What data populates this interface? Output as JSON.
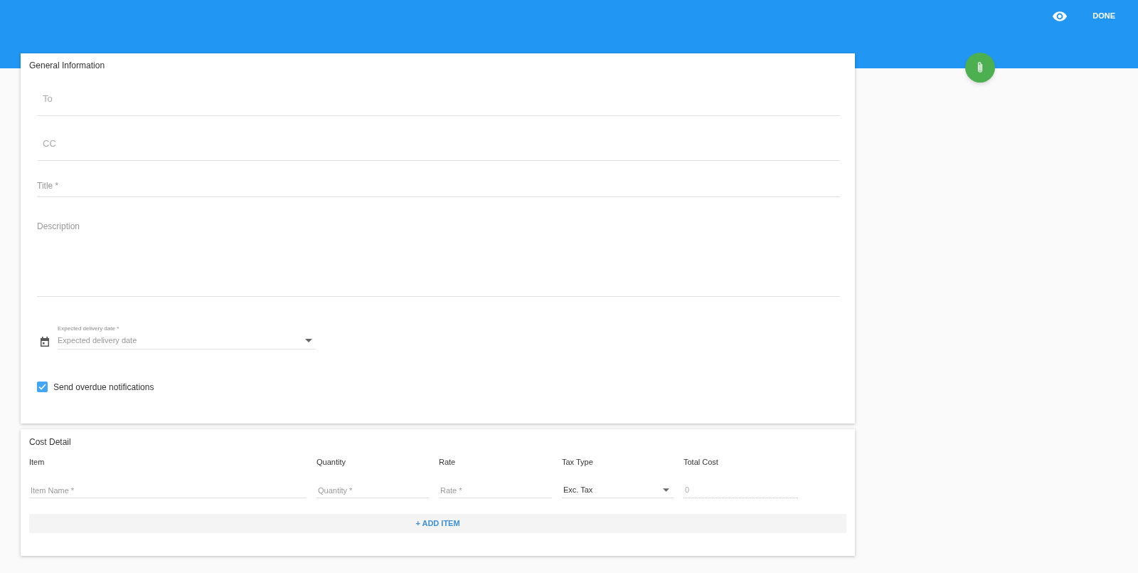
{
  "toolbar": {
    "done_label": "DONE"
  },
  "general_information": {
    "title": "General Information",
    "fields": [
      {
        "kind": "recipient",
        "placeholder": "To"
      },
      {
        "kind": "recipient",
        "placeholder": "CC"
      },
      {
        "kind": "single",
        "placeholder": "Title *"
      },
      {
        "kind": "multiline",
        "placeholder": "Description"
      }
    ],
    "delivery_date": {
      "label": "Expected delivery date *",
      "placeholder": "Expected delivery date"
    },
    "overdue_notifications": {
      "label": "Send overdue notifications",
      "checked": true
    }
  },
  "cost_detail": {
    "title": "Cost Detail",
    "columns": [
      "Item",
      "Quantity",
      "Rate",
      "Tax Type",
      "Total Cost"
    ],
    "row": [
      {
        "kind": "input",
        "placeholder": "Item Name *"
      },
      {
        "kind": "input",
        "placeholder": "Quantity *"
      },
      {
        "kind": "input",
        "placeholder": "Rate *"
      },
      {
        "kind": "select",
        "value": "Exc. Tax"
      },
      {
        "kind": "readonly",
        "value": "0"
      }
    ],
    "add_item_label": "+ ADD ITEM"
  }
}
